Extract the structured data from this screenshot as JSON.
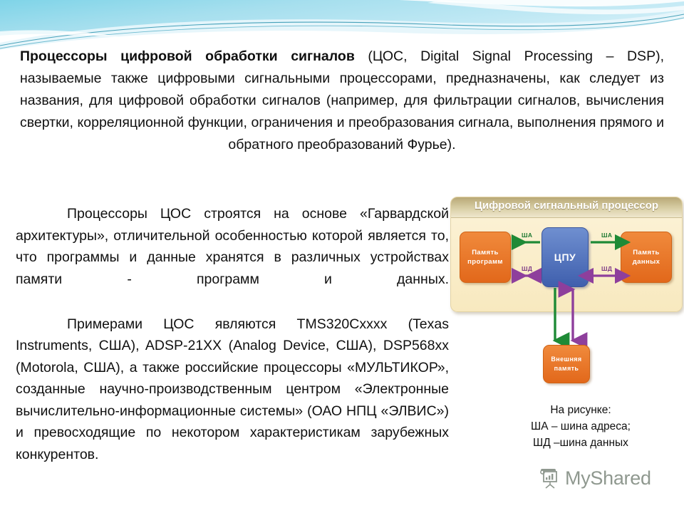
{
  "slide": {
    "background_color": "#ffffff",
    "header": {
      "name": "decorative-wave-band",
      "colors": {
        "cyan_light": "#9fdcec",
        "cyan_mid": "#5ec3dd",
        "teal": "#2f9fbb",
        "teal_dark": "#1d7f9c",
        "white": "#ffffff"
      }
    }
  },
  "intro": {
    "lead": "Процессоры цифровой обработки сигналов",
    "rest": " (ЦОС, Digital Signal Processing – DSP), называемые также цифровыми сигнальными процессорами, предназначены, как следует из названия, для цифровой обработки сигналов (например, для фильтрации сигналов, вычисления свертки, корреляционной функции, ограничения и преобразования сигнала, выполнения прямого и обратного преобразований Фурье)."
  },
  "body": {
    "paragraph_architecture": "Процессоры ЦОС строятся на основе «Гарвардской архитектуры», отличительной особенностью которой является то, что программы и данные хранятся в различных устройствах памяти - программ и данных.",
    "paragraph_examples": "Примерами ЦОС являются TMS320Cxxxx (Texas Instruments, США), ADSP-21XX (Analog Device, США), DSP568xx (Motorola, США), а также российские процессоры «МУЛЬТИКОР», созданные научно-производственным центром «Электронные вычислительно-информационные системы» (ОАО НПЦ «ЭЛВИС») и превосходящие по некотором характеристикам зарубежных конкурентов."
  },
  "diagram": {
    "title": "Цифровой сигнальный процессор",
    "blocks": {
      "memory_program": "Память программ",
      "cpu": "ЦПУ",
      "memory_data": "Память данных",
      "external_memory": "Внешняя память"
    },
    "bus_labels": {
      "address_left": "ША",
      "address_right": "ША",
      "data_left": "ШД",
      "data_right": "ШД"
    },
    "colors": {
      "panel_background": "#fcf3d8",
      "title_bar": "#c7b986",
      "memory_block": "#e8761f",
      "cpu_block": "#4a68b4",
      "address_bus_arrow": "#1e8a36",
      "data_bus_arrow": "#8e3f9c"
    }
  },
  "caption": {
    "line1": "На рисунке:",
    "line2": "ША – шина адреса;",
    "line3": "ШД –шина данных"
  },
  "watermark": {
    "text": "MyShared",
    "icon": "presentation-chart-icon",
    "color": "#4b5a4b"
  }
}
